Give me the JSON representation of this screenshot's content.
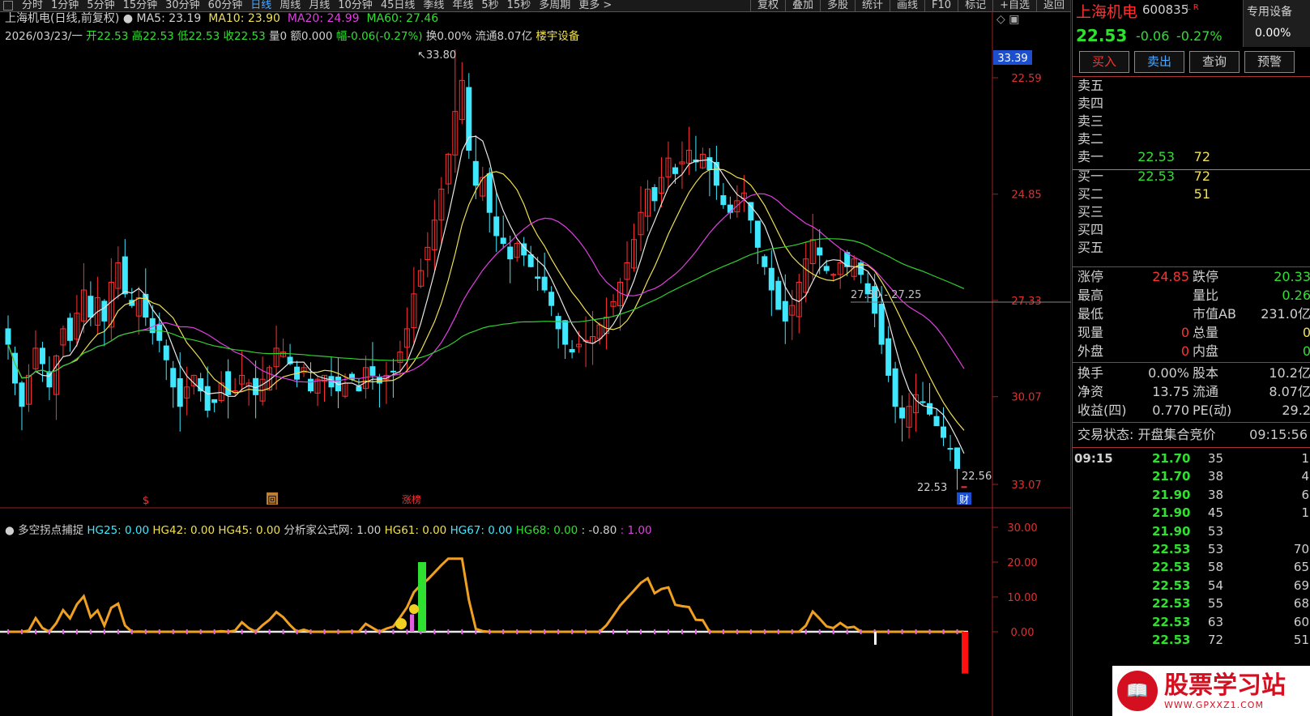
{
  "toolbar": {
    "periods": [
      "分时",
      "1分钟",
      "5分钟",
      "15分钟",
      "30分钟",
      "60分钟",
      "日线",
      "周线",
      "月线",
      "10分钟",
      "45日线",
      "季线",
      "年线",
      "5秒",
      "15秒",
      "多周期",
      "更多 >"
    ],
    "active": "日线",
    "right_buttons": [
      "复权",
      "叠加",
      "多股",
      "统计",
      "画线",
      "F10",
      "标记",
      "+自选",
      "返回"
    ]
  },
  "main": {
    "title": "上海机电(日线,前复权)",
    "ma": {
      "ma5": "MA5: 23.19",
      "ma10": "MA10: 23.90",
      "ma20": "MA20: 24.99",
      "ma60": "MA60: 27.46"
    },
    "info": {
      "date": "2026/03/23/一",
      "open": "开22.53",
      "high": "高22.53",
      "low": "低22.53",
      "close": "收22.53",
      "vol": "量0",
      "amt": "额0.000",
      "chg": "幅-0.06(-0.27%)",
      "turn": "换0.00%",
      "float": "流通8.07亿",
      "concept": "楼宇设备"
    },
    "price_axis": [
      "33.07",
      "30.07",
      "27.33",
      "24.85",
      "22.59"
    ],
    "price_axis_hl": "33.39",
    "annot": {
      "high": "33.80",
      "range": "27.30 - 27.25",
      "last_low": "22.53",
      "last": "22.56"
    },
    "markers": [
      "$",
      "回",
      "涨榜",
      "财"
    ]
  },
  "sub": {
    "title": "多空拐点捕捉",
    "items": [
      {
        "t": "HG25: 0.00",
        "c": "c"
      },
      {
        "t": "HG42: 0.00",
        "c": "y"
      },
      {
        "t": "HG45: 0.00",
        "c": "y"
      },
      {
        "t": "分析家公式网: 1.00",
        "c": "w"
      },
      {
        "t": "HG61: 0.00",
        "c": "y"
      },
      {
        "t": "HG67: 0.00",
        "c": "c"
      },
      {
        "t": "HG68: 0.00",
        "c": "g"
      },
      {
        "t": ": -0.80",
        "c": "w"
      },
      {
        "t": ": 1.00",
        "c": "m"
      }
    ],
    "axis": [
      "30.00",
      "20.00",
      "10.00",
      "0.00"
    ]
  },
  "quote": {
    "name": "上海机电",
    "code": "600835",
    "tag": "L R",
    "special": "专用设备",
    "special_pct": "0.00%",
    "price": "22.53",
    "chg": "-0.06",
    "pct": "-0.27%",
    "buttons": [
      "买入",
      "卖出",
      "查询",
      "预警"
    ],
    "asks": [
      {
        "l": "卖五",
        "p": "",
        "v": ""
      },
      {
        "l": "卖四",
        "p": "",
        "v": ""
      },
      {
        "l": "卖三",
        "p": "",
        "v": ""
      },
      {
        "l": "卖二",
        "p": "",
        "v": ""
      },
      {
        "l": "卖一",
        "p": "22.53",
        "v": "72"
      }
    ],
    "bids": [
      {
        "l": "买一",
        "p": "22.53",
        "v": "72"
      },
      {
        "l": "买二",
        "p": "",
        "v": "51"
      },
      {
        "l": "买三",
        "p": "",
        "v": ""
      },
      {
        "l": "买四",
        "p": "",
        "v": ""
      },
      {
        "l": "买五",
        "p": "",
        "v": ""
      }
    ],
    "stats1": [
      {
        "l1": "涨停",
        "v1": "24.85",
        "c1": "r",
        "l2": "跌停",
        "v2": "20.33",
        "c2": "g"
      },
      {
        "l1": "最高",
        "v1": "",
        "c1": "w",
        "l2": "量比",
        "v2": "0.26",
        "c2": "g"
      },
      {
        "l1": "最低",
        "v1": "",
        "c1": "w",
        "l2": "市值AB",
        "v2": "231.0亿",
        "c2": "w"
      },
      {
        "l1": "现量",
        "v1": "0",
        "c1": "r",
        "l2": "总量",
        "v2": "0",
        "c2": "y"
      },
      {
        "l1": "外盘",
        "v1": "0",
        "c1": "r",
        "l2": "内盘",
        "v2": "0",
        "c2": "g"
      }
    ],
    "stats2": [
      {
        "l1": "换手",
        "v1": "0.00%",
        "l2": "股本",
        "v2": "10.2亿"
      },
      {
        "l1": "净资",
        "v1": "13.75",
        "l2": "流通",
        "v2": "8.07亿"
      },
      {
        "l1": "收益(四)",
        "v1": "0.770",
        "l2": "PE(动)",
        "v2": "29.2"
      }
    ],
    "status_label": "交易状态: 开盘集合竞价",
    "status_time": "09:15:56",
    "ticks": [
      {
        "t": "09:15",
        "p": "21.70",
        "v": "35",
        "n": "1"
      },
      {
        "t": "",
        "p": "21.70",
        "v": "38",
        "n": "4"
      },
      {
        "t": "",
        "p": "21.90",
        "v": "38",
        "n": "6"
      },
      {
        "t": "",
        "p": "21.90",
        "v": "45",
        "n": "1"
      },
      {
        "t": "",
        "p": "21.90",
        "v": "53",
        "n": ""
      },
      {
        "t": "",
        "p": "22.53",
        "v": "53",
        "n": "70"
      },
      {
        "t": "",
        "p": "22.53",
        "v": "58",
        "n": "65"
      },
      {
        "t": "",
        "p": "22.53",
        "v": "54",
        "n": "69"
      },
      {
        "t": "",
        "p": "22.53",
        "v": "55",
        "n": "68"
      },
      {
        "t": "",
        "p": "22.53",
        "v": "63",
        "n": "60"
      },
      {
        "t": "",
        "p": "22.53",
        "v": "72",
        "n": "51"
      }
    ]
  },
  "watermark": {
    "text": "股票学习站",
    "url": "WWW.GPXXZ1.COM"
  },
  "chart_data": {
    "type": "candlestick",
    "price_axis": [
      22.59,
      24.85,
      27.33,
      30.07,
      33.07
    ],
    "closes": [
      26.2,
      25.2,
      24.6,
      25.4,
      26.1,
      25.7,
      25.1,
      25.9,
      26.6,
      26.3,
      27.0,
      27.6,
      26.9,
      27.4,
      26.8,
      27.8,
      28.3,
      27.5,
      27.2,
      27.4,
      26.9,
      26.5,
      26.3,
      25.8,
      25.1,
      24.6,
      25.1,
      25.4,
      25.0,
      24.5,
      24.7,
      25.2,
      24.9,
      25.0,
      25.4,
      25.2,
      24.9,
      25.3,
      25.6,
      26.1,
      26.0,
      25.7,
      25.3,
      25.6,
      25.0,
      25.3,
      25.4,
      25.1,
      25.0,
      25.2,
      25.3,
      25.0,
      25.6,
      25.4,
      25.2,
      25.4,
      25.5,
      26.0,
      26.6,
      27.5,
      28.1,
      28.7,
      29.4,
      30.2,
      31.1,
      32.2,
      33.0,
      31.2,
      30.3,
      30.5,
      29.6,
      29.0,
      28.8,
      28.4,
      28.8,
      28.5,
      28.2,
      27.9,
      27.6,
      27.2,
      26.6,
      26.2,
      26.0,
      26.2,
      26.3,
      26.4,
      26.7,
      26.9,
      27.3,
      27.8,
      28.3,
      28.9,
      29.6,
      30.2,
      29.9,
      30.5,
      31.0,
      30.6,
      30.9,
      31.2,
      30.9,
      31.1,
      30.7,
      30.3,
      29.8,
      29.6,
      29.9,
      30.1,
      29.4,
      28.7,
      28.2,
      27.6,
      27.1,
      26.8,
      27.2,
      27.8,
      28.4,
      28.9,
      28.5,
      28.1,
      28.0,
      28.3,
      28.2,
      28.4,
      28.0,
      27.5,
      27.0,
      26.2,
      25.4,
      24.6,
      24.3,
      24.6,
      24.9,
      24.7,
      24.4,
      24.1,
      23.8,
      23.5,
      23.0,
      22.53
    ],
    "ma60_last": 27.46,
    "sub_range": [
      -6,
      34
    ]
  }
}
